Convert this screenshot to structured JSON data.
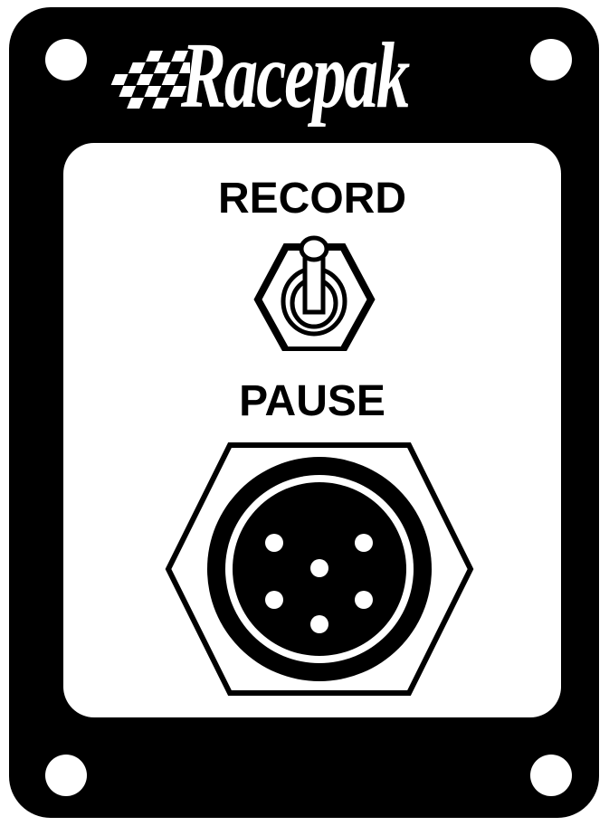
{
  "brand": {
    "name": "Racepak",
    "logo_mark": "checkered-flag-icon"
  },
  "panel": {
    "color": "#000000",
    "face_color": "#ffffff"
  },
  "switch": {
    "upper_label": "RECORD",
    "lower_label": "PAUSE",
    "icon": "toggle-switch-icon"
  },
  "connector": {
    "icon": "round-connector-icon",
    "pin_count": 6
  }
}
